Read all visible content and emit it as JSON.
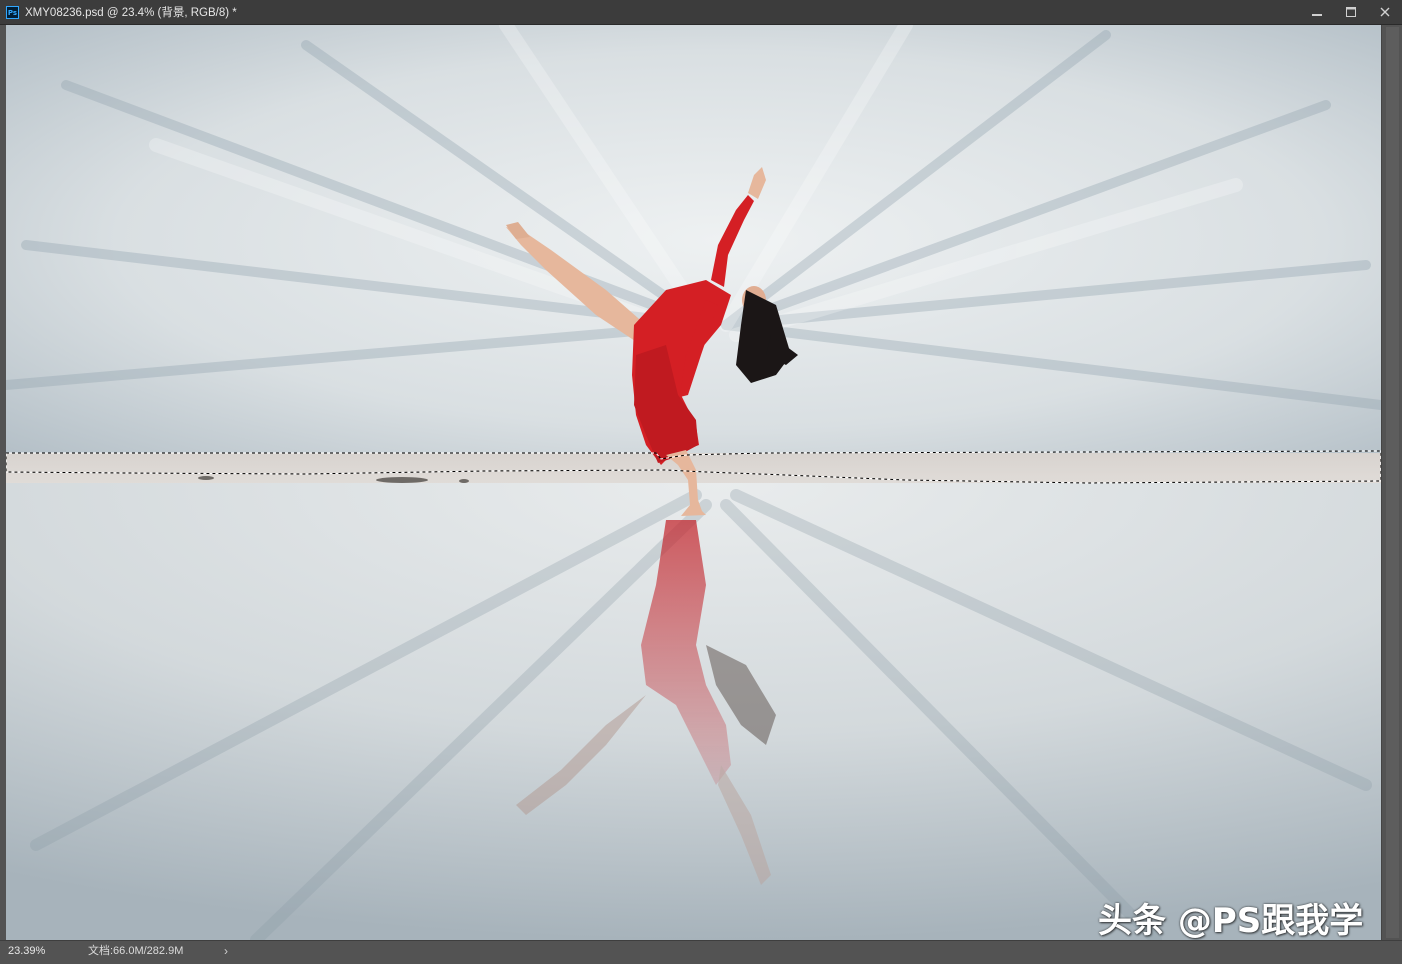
{
  "window": {
    "title": "XMY08236.psd @ 23.4% (背景, RGB/8) *",
    "app_icon_text": "Ps",
    "controls": {
      "minimize": "minimize-icon",
      "maximize": "maximize-icon",
      "close": "close-icon"
    }
  },
  "status": {
    "zoom": "23.39%",
    "doc_info": "文档:66.0M/282.9M",
    "arrow": "›"
  },
  "watermark": {
    "text": "头条 @PS跟我学"
  },
  "colors": {
    "titlebar": "#3c3c3c",
    "workspace": "#535353",
    "dress": "#d41f24",
    "sky": "#cfd6da"
  }
}
